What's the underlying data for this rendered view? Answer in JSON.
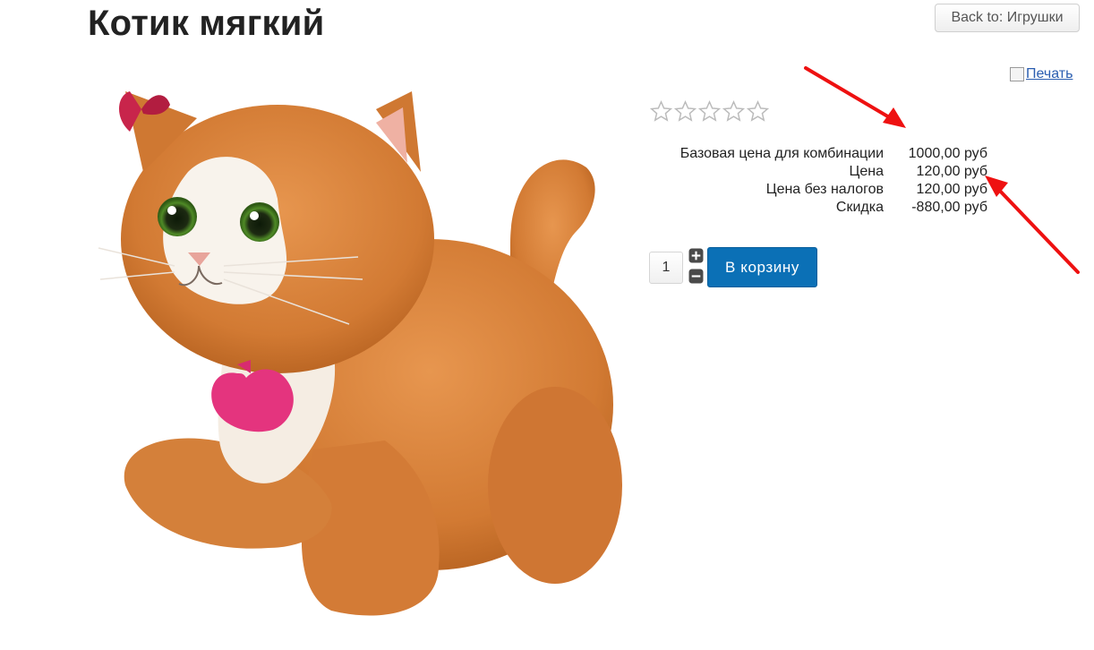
{
  "header": {
    "title": "Котик мягкий",
    "back_label": "Back to: Игрушки"
  },
  "print": {
    "label": "Печать"
  },
  "product": {
    "image": "plush-orange-cat-image",
    "rating_stars": 5,
    "rating_value": 0
  },
  "prices": [
    {
      "label": "Базовая цена для комбинации",
      "value": "1000,00 руб"
    },
    {
      "label": "Цена",
      "value": "120,00 руб"
    },
    {
      "label": "Цена без налогов",
      "value": "120,00 руб"
    },
    {
      "label": "Скидка",
      "value": "-880,00 руб"
    }
  ],
  "cart": {
    "quantity": "1",
    "add_label": "В корзину"
  },
  "colors": {
    "button_blue": "#0b70b6",
    "annotation_red": "#ee1111",
    "cat_orange": "#d9823a"
  }
}
